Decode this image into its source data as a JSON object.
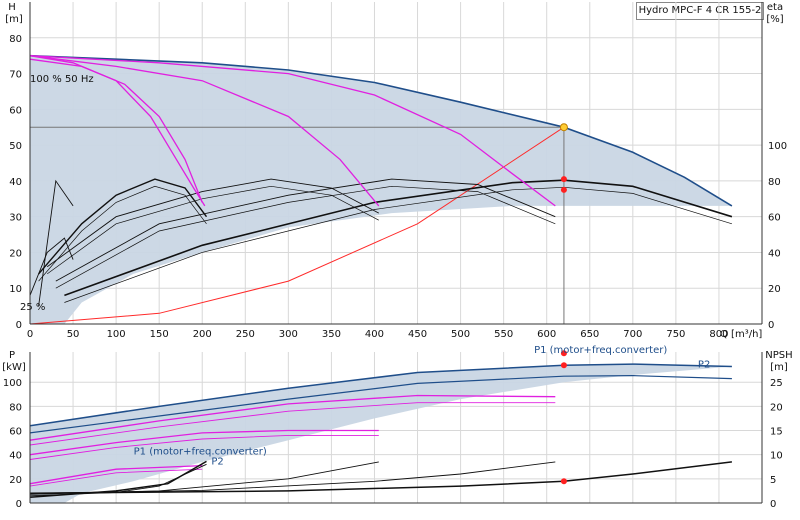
{
  "title": "Hydro MPC-F 4 CR 155-2",
  "colors": {
    "envelope_fill": "#c9d6e4",
    "envelope_line": "#1f4e8a",
    "speed_curves": "#e020e0",
    "efficiency_curves": "#111111",
    "system_curve": "#ff2a2a",
    "duty_point": "#ff2020",
    "duty_point_top": "#ffcc33",
    "grid": "#d8d8d8",
    "axis": "#333333"
  },
  "chart_data": [
    {
      "id": "head",
      "type": "line",
      "ylabel_left": [
        "H",
        "[m]"
      ],
      "ylabel_right": [
        "eta",
        "[%]"
      ],
      "xlabel": "Q [m³/h]",
      "xlim": [
        0,
        850
      ],
      "ylim": [
        0,
        90
      ],
      "y2lim": [
        0,
        180
      ],
      "grid": true,
      "x_ticks": [
        0,
        50,
        100,
        150,
        200,
        250,
        300,
        350,
        400,
        450,
        500,
        550,
        600,
        650,
        700,
        750,
        800
      ],
      "y_ticks": [
        0,
        10,
        20,
        30,
        40,
        50,
        60,
        70,
        80
      ],
      "y2_ticks": [
        0,
        20,
        40,
        60,
        80,
        100
      ],
      "annotations": [
        "100 % 50 Hz",
        "25 %"
      ],
      "envelope_upper": [
        [
          0,
          75
        ],
        [
          100,
          74
        ],
        [
          200,
          73
        ],
        [
          300,
          71
        ],
        [
          400,
          67.5
        ],
        [
          500,
          62
        ],
        [
          620,
          55
        ],
        [
          700,
          48
        ],
        [
          760,
          41
        ],
        [
          815,
          33
        ]
      ],
      "envelope_lower": [
        [
          815,
          33
        ],
        [
          700,
          33
        ],
        [
          560,
          33
        ],
        [
          420,
          31
        ],
        [
          300,
          27
        ],
        [
          200,
          20
        ],
        [
          120,
          14
        ],
        [
          60,
          6
        ],
        [
          40,
          0
        ],
        [
          0,
          0
        ]
      ],
      "speed_curves": [
        [
          [
            0,
            75
          ],
          [
            50,
            73
          ],
          [
            100,
            68
          ],
          [
            140,
            58
          ],
          [
            170,
            46
          ],
          [
            190,
            38
          ],
          [
            203,
            33
          ]
        ],
        [
          [
            0,
            75
          ],
          [
            100,
            72
          ],
          [
            200,
            68
          ],
          [
            300,
            58
          ],
          [
            360,
            46
          ],
          [
            405,
            33
          ]
        ],
        [
          [
            0,
            75
          ],
          [
            150,
            73
          ],
          [
            300,
            70
          ],
          [
            400,
            64
          ],
          [
            500,
            53
          ],
          [
            560,
            42
          ],
          [
            610,
            33
          ]
        ],
        [
          [
            0,
            74
          ],
          [
            60,
            72
          ],
          [
            110,
            67
          ],
          [
            150,
            58
          ],
          [
            180,
            46
          ],
          [
            200,
            34
          ]
        ]
      ],
      "efficiency_curves": [
        [
          [
            0,
            8
          ],
          [
            20,
            20
          ],
          [
            40,
            24
          ],
          [
            50,
            18
          ]
        ],
        [
          [
            10,
            14
          ],
          [
            60,
            28
          ],
          [
            100,
            36
          ],
          [
            145,
            40.5
          ],
          [
            180,
            38
          ],
          [
            205,
            30
          ]
        ],
        [
          [
            20,
            16
          ],
          [
            100,
            30
          ],
          [
            200,
            37
          ],
          [
            280,
            40.5
          ],
          [
            350,
            38
          ],
          [
            405,
            31
          ]
        ],
        [
          [
            30,
            12
          ],
          [
            150,
            28
          ],
          [
            300,
            36
          ],
          [
            420,
            40.5
          ],
          [
            520,
            39
          ],
          [
            610,
            30
          ]
        ],
        [
          [
            40,
            8
          ],
          [
            200,
            22
          ],
          [
            400,
            34
          ],
          [
            560,
            39.5
          ],
          [
            620,
            40.2
          ],
          [
            700,
            38.5
          ],
          [
            815,
            30
          ]
        ],
        [
          [
            10,
            5
          ],
          [
            30,
            40
          ],
          [
            50,
            33
          ]
        ]
      ],
      "system_curve": [
        [
          0,
          0
        ],
        [
          150,
          3
        ],
        [
          300,
          12
        ],
        [
          450,
          28
        ],
        [
          620,
          55
        ]
      ],
      "duty_flow": 620,
      "duty_head": 55,
      "duty_markers": [
        [
          620,
          55
        ],
        [
          620,
          40.5
        ],
        [
          620,
          37.5
        ]
      ]
    },
    {
      "id": "power",
      "type": "line",
      "ylabel_left": [
        "P",
        "[kW]"
      ],
      "ylabel_right": [
        "NPSH",
        "[m]"
      ],
      "xlim": [
        0,
        850
      ],
      "ylim": [
        0,
        125
      ],
      "y2lim": [
        0,
        31.25
      ],
      "grid": true,
      "y_ticks": [
        0,
        20,
        40,
        60,
        80,
        100
      ],
      "y2_ticks": [
        0,
        5,
        10,
        15,
        20,
        25
      ],
      "series_labels": [
        {
          "text": "P1 (motor+freq.converter)",
          "at": [
            740,
            124
          ]
        },
        {
          "text": "P2",
          "at": [
            790,
            112
          ]
        },
        {
          "text": "P1 (motor+freq.converter)",
          "at": [
            275,
            40
          ]
        },
        {
          "text": "P2",
          "at": [
            225,
            32
          ]
        }
      ],
      "envelope_upper": [
        [
          0,
          64
        ],
        [
          150,
          80
        ],
        [
          300,
          95
        ],
        [
          450,
          108
        ],
        [
          620,
          114
        ],
        [
          700,
          115
        ],
        [
          815,
          113
        ]
      ],
      "envelope_lower": [
        [
          815,
          113
        ],
        [
          700,
          106
        ],
        [
          620,
          100
        ],
        [
          500,
          86
        ],
        [
          400,
          70
        ],
        [
          300,
          52
        ],
        [
          200,
          34
        ],
        [
          120,
          18
        ],
        [
          60,
          8
        ],
        [
          40,
          0
        ],
        [
          0,
          0
        ]
      ],
      "envelope_p2_inner": [
        [
          0,
          58
        ],
        [
          150,
          72
        ],
        [
          300,
          86
        ],
        [
          450,
          99
        ],
        [
          620,
          105
        ],
        [
          700,
          105.5
        ],
        [
          815,
          103
        ]
      ],
      "speed_p1": [
        [
          [
            0,
            16
          ],
          [
            100,
            28
          ],
          [
            200,
            31
          ]
        ],
        [
          [
            0,
            40
          ],
          [
            100,
            50
          ],
          [
            200,
            58
          ],
          [
            300,
            60
          ],
          [
            405,
            60
          ]
        ],
        [
          [
            0,
            52
          ],
          [
            150,
            68
          ],
          [
            300,
            82
          ],
          [
            450,
            89
          ],
          [
            610,
            88
          ]
        ]
      ],
      "speed_p2": [
        [
          [
            0,
            14
          ],
          [
            100,
            25
          ],
          [
            200,
            28
          ]
        ],
        [
          [
            0,
            36
          ],
          [
            100,
            46
          ],
          [
            200,
            53
          ],
          [
            300,
            56
          ],
          [
            405,
            56
          ]
        ],
        [
          [
            0,
            48
          ],
          [
            150,
            63
          ],
          [
            300,
            76
          ],
          [
            450,
            83
          ],
          [
            610,
            83
          ]
        ]
      ],
      "npsh_curves": [
        [
          [
            0,
            1.5
          ],
          [
            100,
            2.2
          ],
          [
            150,
            3.5
          ],
          [
            205,
            8
          ]
        ],
        [
          [
            0,
            1.8
          ],
          [
            150,
            2.5
          ],
          [
            300,
            5
          ],
          [
            405,
            8.5
          ]
        ],
        [
          [
            0,
            2
          ],
          [
            200,
            2.6
          ],
          [
            400,
            4.5
          ],
          [
            500,
            6
          ],
          [
            610,
            8.5
          ]
        ],
        [
          [
            0,
            2
          ],
          [
            300,
            2.5
          ],
          [
            500,
            3.5
          ],
          [
            620,
            4.5
          ],
          [
            700,
            6
          ],
          [
            815,
            8.5
          ]
        ],
        [
          [
            0,
            1.2
          ],
          [
            100,
            2.5
          ],
          [
            160,
            4
          ],
          [
            205,
            8.6
          ]
        ]
      ],
      "duty_markers": [
        [
          620,
          124
        ],
        [
          620,
          114
        ]
      ],
      "npsh_duty_marker": [
        620,
        4.5
      ]
    }
  ]
}
